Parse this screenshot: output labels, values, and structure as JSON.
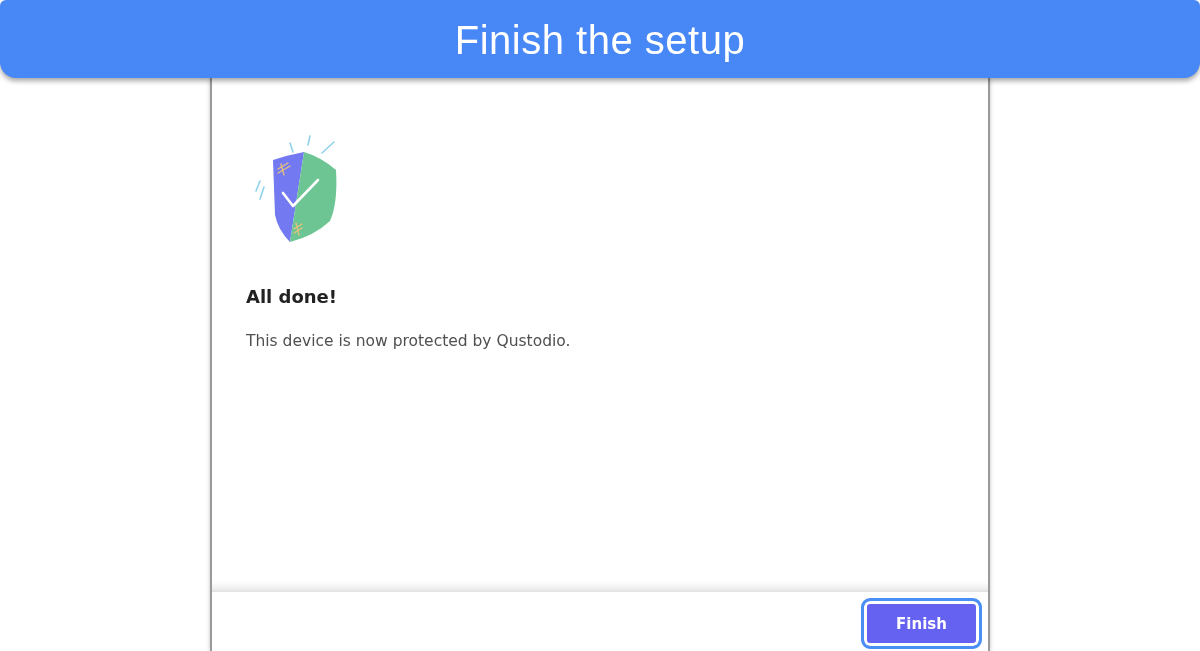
{
  "banner": {
    "title": "Finish the setup"
  },
  "dialog": {
    "heading": "All done!",
    "message": "This device is now protected by Qustodio.",
    "buttons": [
      {
        "label": "Finish",
        "focused": true
      }
    ]
  }
}
